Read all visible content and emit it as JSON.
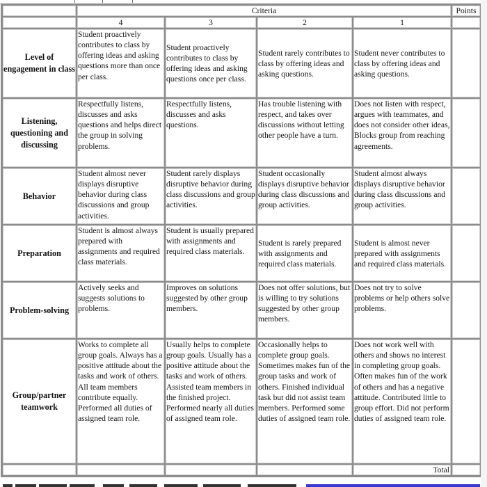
{
  "rubric": {
    "header": {
      "criteria_label": "Criteria",
      "points_label": "Points",
      "scores": [
        "4",
        "3",
        "2",
        "1"
      ]
    },
    "rows": [
      {
        "category": "Level of engagement in class",
        "levels": [
          "Student proactively contributes to class by offering ideas and asking questions more than once per class.",
          "Student proactively contributes to class by offering ideas and asking questions once per class.",
          "Student rarely contributes to class by offering ideas and asking questions.",
          "Student never contributes to class by offering ideas and asking questions."
        ],
        "points": ""
      },
      {
        "category": "Listening, questioning and discussing",
        "levels": [
          "Respectfully listens, discusses and asks questions and helps direct the group in solving problems.",
          "Respectfully listens, discusses and asks questions.",
          "Has trouble listening with respect, and takes over discussions without letting other people have a turn.",
          "Does not listen with respect, argues with teammates, and does not consider other ideas, Blocks group from reaching agreements."
        ],
        "points": ""
      },
      {
        "category": "Behavior",
        "levels": [
          "Student almost never displays disruptive behavior during class discussions and group activities.",
          "Student rarely displays disruptive behavior during class discussions and group activities.",
          "Student occasionally displays disruptive behavior during class discussions and group activities.",
          "Student almost always displays disruptive behavior during class discussions and group activities."
        ],
        "points": ""
      },
      {
        "category": "Preparation",
        "levels": [
          "Student is almost always prepared with assignments and required class materials.",
          "Student is usually prepared with assignments and required class materials.",
          "Student is rarely prepared with assignments and required class materials.",
          "Student is almost never prepared with assignments and required class materials."
        ],
        "points": ""
      },
      {
        "category": "Problem-solving",
        "levels": [
          "Actively seeks and suggests solutions to problems.",
          "Improves on solutions suggested by other group members.",
          "Does not offer solutions, but is willing to try solutions suggested by other group members.",
          "Does not try to solve problems or help others solve problems."
        ],
        "points": ""
      },
      {
        "category": "Group/partner teamwork",
        "levels": [
          "Works to complete all group goals. Always has a positive attitude about the tasks and work of others. All team members contribute equally. Performed all duties of assigned team role.",
          "Usually helps to complete group goals. Usually has a positive attitude about the tasks and work of others. Assisted team members in the finished project. Performed nearly all duties of assigned team role.",
          "Occasionally helps to complete group goals. Sometimes makes fun of the group tasks and work of others. Finished individual task but did not assist team members. Performed some duties of assigned team role.",
          "Does not work well with others and shows no interest in completing group goals. Often makes fun of the work of others and has a negative attitude. Contributed little to group effort. Did not perform duties of assigned team role."
        ],
        "points": ""
      }
    ],
    "total_label": "Total",
    "total_value": ""
  }
}
